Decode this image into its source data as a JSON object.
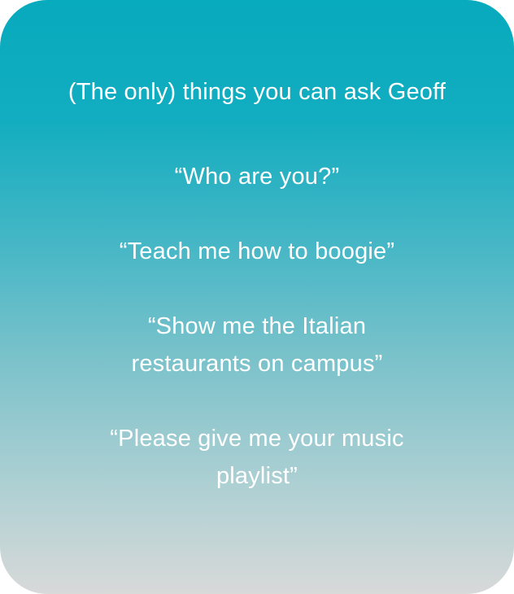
{
  "card": {
    "title": "(The only) things you can ask Geoff",
    "questions": [
      {
        "lines": [
          "“Who are you?”"
        ]
      },
      {
        "lines": [
          "“Teach me how to boogie”"
        ]
      },
      {
        "lines": [
          "“Show me the Italian",
          "restaurants on campus”"
        ]
      },
      {
        "lines": [
          "“Please give me your music",
          "playlist”"
        ]
      }
    ]
  },
  "colors": {
    "gradient_top": "#08aabd",
    "gradient_bottom": "#d8d9d9",
    "text": "#ffffff"
  }
}
